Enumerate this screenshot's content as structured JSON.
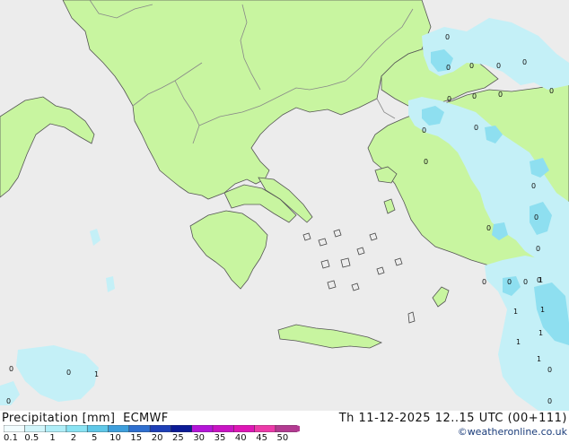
{
  "legend": {
    "title": "Precipitation [mm]",
    "model": "ECMWF",
    "ticks": [
      "0.1",
      "0.5",
      "1",
      "2",
      "5",
      "10",
      "15",
      "20",
      "25",
      "30",
      "35",
      "40",
      "45",
      "50"
    ],
    "colors": [
      "#f2fdff",
      "#d2f6fb",
      "#b0eef8",
      "#8ae3f3",
      "#5fc8e8",
      "#3e9fdc",
      "#2f6fd0",
      "#1e3fb7",
      "#0c1b96",
      "#b415d8",
      "#c914c4",
      "#de16b6",
      "#ec3aa9",
      "#b33a91"
    ]
  },
  "datetime": "Th 11-12-2025 12..15 UTC (00+111)",
  "credit": "©weatheronline.co.uk",
  "map_labels": [
    "0",
    "0",
    "0",
    "0",
    "0",
    "0",
    "0",
    "0",
    "0",
    "0",
    "0",
    "0",
    "0",
    "0",
    "0",
    "0",
    "0",
    "0",
    "0",
    "0",
    "1",
    "1",
    "1",
    "1",
    "1",
    "1",
    "1",
    "0",
    "0",
    "0",
    "0",
    "0"
  ],
  "map_colors": {
    "sea": "#ececec",
    "land": "#c8f5a0",
    "border": "#888888",
    "coast": "#444444",
    "precip_light": "#c4f0f7",
    "precip_medium": "#8edff0"
  }
}
